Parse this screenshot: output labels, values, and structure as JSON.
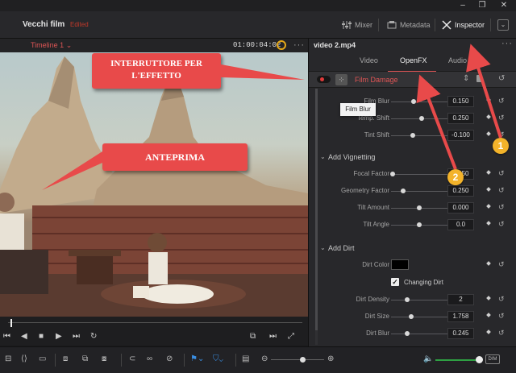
{
  "window": {
    "minimize_icon": "–",
    "restore_icon": "❐",
    "close_icon": "✕"
  },
  "header": {
    "project_name": "Vecchi film",
    "project_status": "Edited",
    "mixer_label": "Mixer",
    "metadata_label": "Metadata",
    "inspector_label": "Inspector"
  },
  "viewer": {
    "timeline_label": "Timeline 1",
    "timecode": "01:00:04:02"
  },
  "inspector": {
    "clip_name": "video 2.mp4",
    "tabs": [
      {
        "label": "Video"
      },
      {
        "label": "OpenFX"
      },
      {
        "label": "Audio"
      }
    ],
    "effect_name": "Film Damage",
    "tooltip": "Film Blur",
    "params_top": [
      {
        "label": "Film Blur",
        "value": "0.150"
      },
      {
        "label": "Temp. Shift",
        "value": "0.250"
      },
      {
        "label": "Tint Shift",
        "value": "-0.100"
      }
    ],
    "group_vignetting": "Add Vignetting",
    "params_vignetting": [
      {
        "label": "Focal Factor",
        "value": "0.250"
      },
      {
        "label": "Geometry Factor",
        "value": "0.250"
      },
      {
        "label": "Tilt Amount",
        "value": "0.000"
      },
      {
        "label": "Tilt Angle",
        "value": "0.0"
      }
    ],
    "group_dirt": "Add Dirt",
    "dirt_color_label": "Dirt Color",
    "changing_dirt_label": "Changing Dirt",
    "params_dirt": [
      {
        "label": "Dirt Density",
        "value": "2"
      },
      {
        "label": "Dirt Size",
        "value": "1.758"
      },
      {
        "label": "Dirt Blur",
        "value": "0.245"
      }
    ]
  },
  "bottombar": {
    "dim_label": "DIM"
  },
  "callouts": {
    "switch": "INTERRUTTORE PER L'EFFETTO",
    "preview": "ANTEPRIMA",
    "badge1": "1",
    "badge2": "2"
  },
  "colors": {
    "accent_red": "#e05555",
    "callout_red": "#e84a4a",
    "badge_yellow": "#f3b32a",
    "volume_green": "#2ea043"
  }
}
